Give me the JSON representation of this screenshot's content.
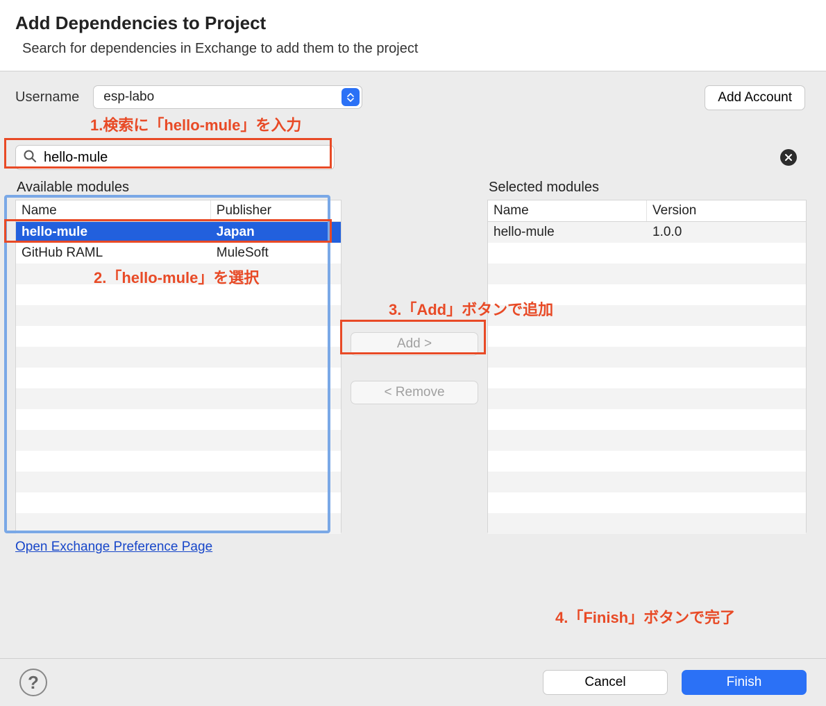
{
  "header": {
    "title": "Add Dependencies to Project",
    "subtitle": "Search for dependencies in Exchange to add them to the project"
  },
  "top": {
    "username_label": "Username",
    "username_value": "esp-labo",
    "add_account_label": "Add Account"
  },
  "search": {
    "value": "hello-mule"
  },
  "available": {
    "label": "Available modules",
    "columns": {
      "name": "Name",
      "publisher": "Publisher"
    },
    "rows": [
      {
        "name": "hello-mule",
        "publisher": "Japan",
        "selected": true
      },
      {
        "name": "GitHub RAML",
        "publisher": "MuleSoft",
        "selected": false
      }
    ],
    "link": "Open Exchange Preference Page"
  },
  "selected": {
    "label": "Selected modules",
    "columns": {
      "name": "Name",
      "version": "Version"
    },
    "rows": [
      {
        "name": "hello-mule",
        "version": "1.0.0"
      }
    ]
  },
  "center": {
    "add_label": "Add >",
    "remove_label": "< Remove"
  },
  "footer": {
    "cancel_label": "Cancel",
    "finish_label": "Finish"
  },
  "annotations": {
    "a1": "1.検索に「hello-mule」を入力",
    "a2": "2.「hello-mule」を選択",
    "a3": "3.「Add」ボタンで追加",
    "a4": "4.「Finish」ボタンで完了"
  }
}
